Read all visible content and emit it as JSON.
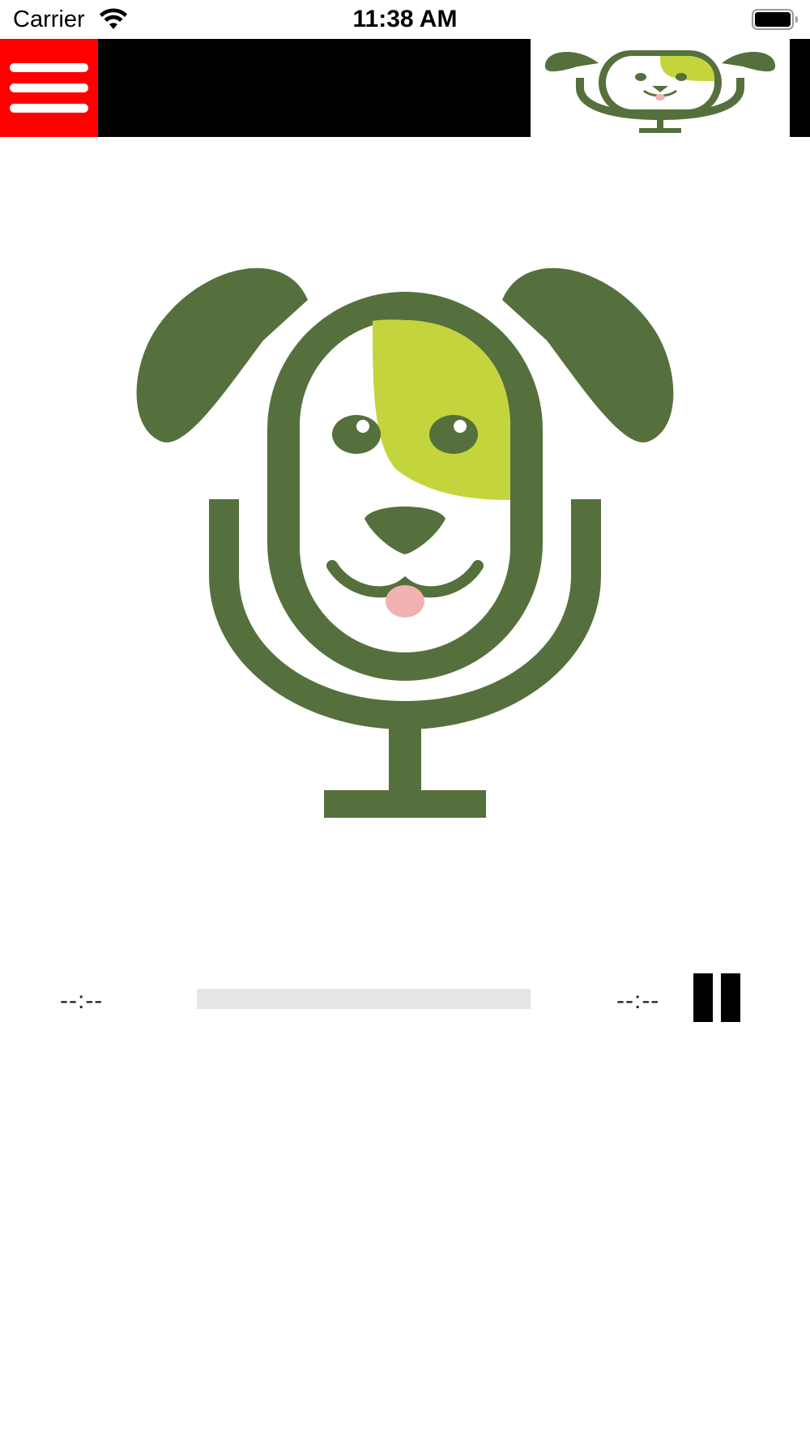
{
  "status_bar": {
    "carrier": "Carrier",
    "time": "11:38 AM",
    "icons": [
      "wifi-icon",
      "battery-icon"
    ]
  },
  "header": {
    "menu_icon": "hamburger-menu-icon",
    "menu_color": "#ff0000",
    "bar_color": "#000000",
    "logo": "dog-microphone-logo"
  },
  "artwork": {
    "image": "dog-microphone-logo",
    "colors": {
      "dark_green": "#55703c",
      "light_green": "#c4d43c",
      "tongue_pink": "#f2b2b2"
    }
  },
  "player": {
    "elapsed": "--:--",
    "remaining": "--:--",
    "progress": 0,
    "pause_icon": "pause-icon"
  }
}
